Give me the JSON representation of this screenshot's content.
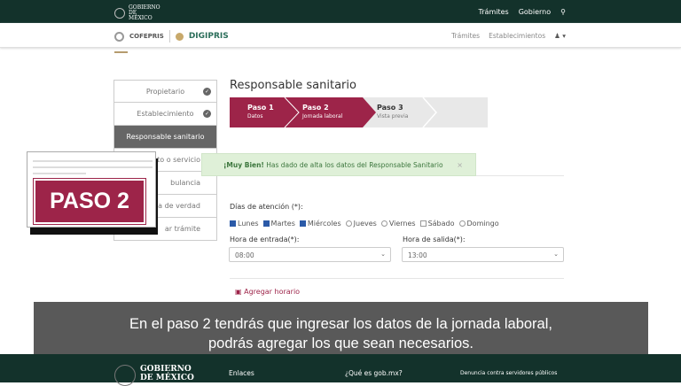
{
  "topbar": {
    "logo": "GOBIERNO DE MÉXICO",
    "nav": [
      "Trámites",
      "Gobierno"
    ],
    "search_icon": "search-icon"
  },
  "navbar": {
    "cofepris": "COFEPRIS",
    "digipris": "DIGIPRIS",
    "nav": [
      "Trámites",
      "Establecimientos"
    ],
    "user_icon": "user-icon"
  },
  "sidebar": {
    "items": [
      {
        "label": "Propietario",
        "done": true
      },
      {
        "label": "Establecimiento",
        "done": true
      },
      {
        "label": "Responsable sanitario"
      },
      {
        "label": "to o servicio"
      },
      {
        "label": "bulancia"
      },
      {
        "label": "a de verdad"
      },
      {
        "label": "ar trámite"
      }
    ]
  },
  "main": {
    "title": "Responsable sanitario",
    "steps": [
      {
        "title": "Paso 1",
        "sub": "Datos"
      },
      {
        "title": "Paso 2",
        "sub": "Jornada laboral"
      },
      {
        "title": "Paso 3",
        "sub": "Vista previa"
      }
    ],
    "alert": {
      "strong": "¡Muy Bien!",
      "text": " Has dado de alta los datos del Responsable Sanitario",
      "close": "×"
    },
    "days_label": "Días de atención (*):",
    "days": [
      {
        "label": "Lunes",
        "checked": true
      },
      {
        "label": "Martes",
        "checked": true
      },
      {
        "label": "Miércoles",
        "checked": true
      },
      {
        "label": "Jueves",
        "checked": false
      },
      {
        "label": "Viernes",
        "checked": false
      },
      {
        "label": "Sábado",
        "checked": false
      },
      {
        "label": "Domingo",
        "checked": false
      }
    ],
    "entrada_label": "Hora de entrada(*):",
    "entrada_value": "08:00",
    "salida_label": "Hora de salida(*):",
    "salida_value": "13:00",
    "add_label": "Agregar horario"
  },
  "overlay": {
    "badge": "PASO 2",
    "subtitle_line1": "En el paso 2 tendrás que ingresar los datos de la jornada laboral,",
    "subtitle_line2": "podrás agregar los que sean necesarios."
  },
  "footer": {
    "logo": "GOBIERNO DE MÉXICO",
    "links": [
      "Enlaces",
      "¿Qué es gob.mx?",
      "Denuncia contra servidores públicos"
    ]
  },
  "colors": {
    "primary": "#9d2449",
    "header": "#13322b",
    "success_bg": "#dff0d8"
  }
}
